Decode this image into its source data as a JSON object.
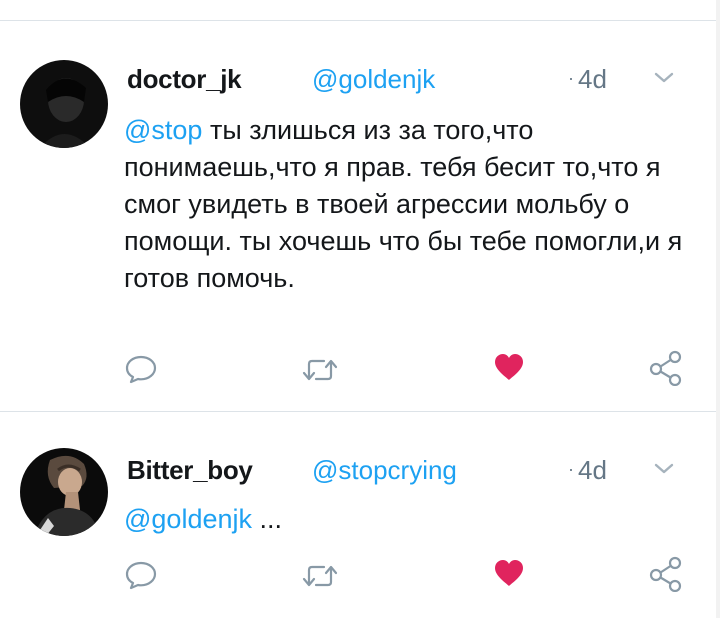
{
  "tweets": [
    {
      "name": "doctor_jk",
      "handle": "@goldenjk",
      "time": "4d",
      "mention": "@stop",
      "text": " ты злишься из за того,что понимаешь,что я прав. тебя бесит то,что я смог увидеть в твоей агрессии мольбу о помощи. ты хочешь что бы тебе помогли,и я готов помочь."
    },
    {
      "name": "Bitter_boy",
      "handle": "@stopcrying",
      "time": "4d",
      "mention": "@goldenjk",
      "text": " ..."
    }
  ],
  "icons": {
    "more": "chevron-down-icon",
    "reply": "reply-icon",
    "retweet": "retweet-icon",
    "like": "heart-icon",
    "share": "share-icon"
  },
  "colors": {
    "link": "#1da1f2",
    "muted": "#657786",
    "text": "#14171a",
    "like": "#e0245e",
    "icon": "#8899a6",
    "divider": "#dde3e8"
  },
  "time_dot": "·"
}
